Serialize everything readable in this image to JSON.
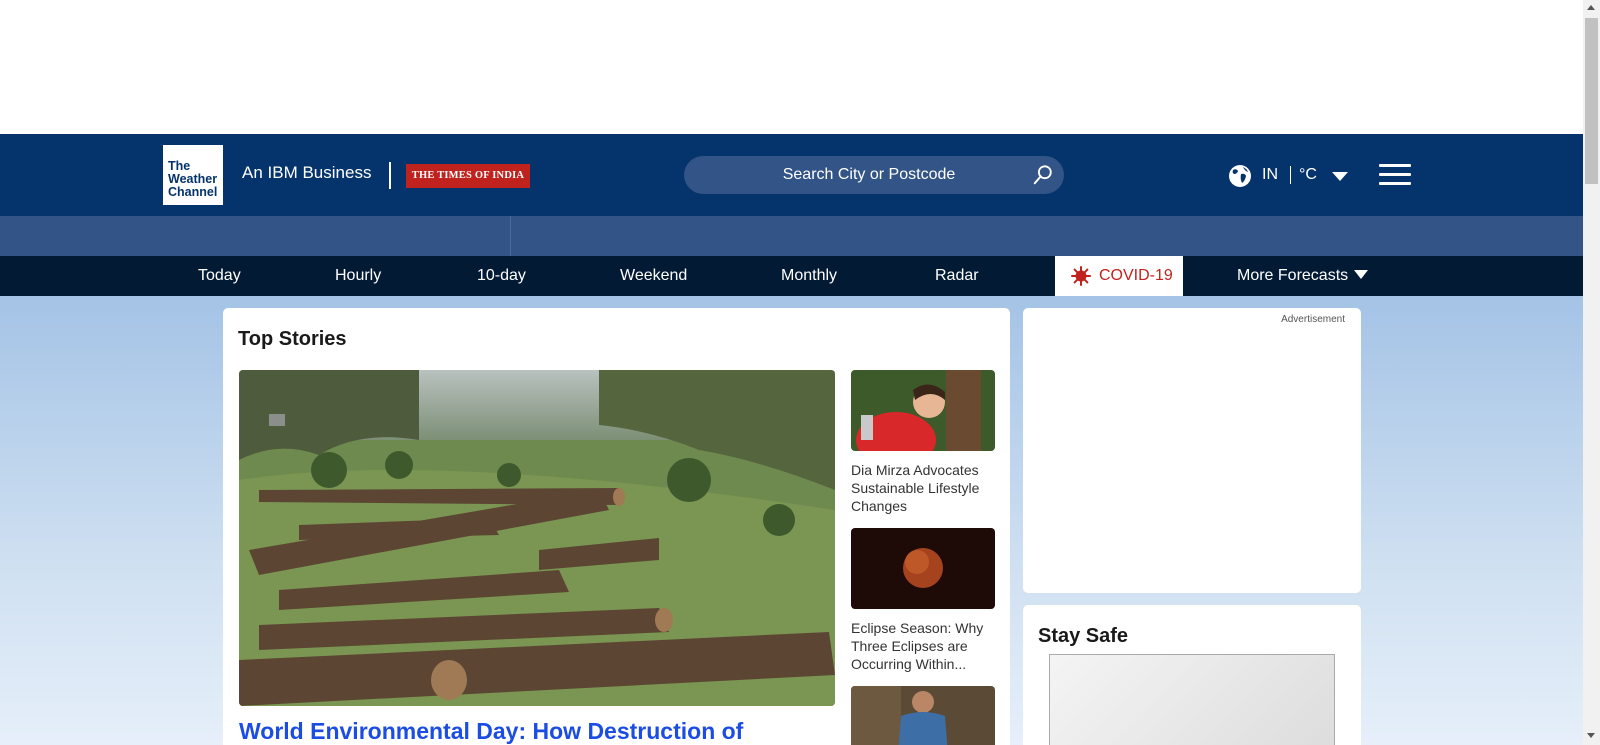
{
  "header": {
    "logo_lines": [
      "The",
      "Weather",
      "Channel"
    ],
    "tagline": "An IBM Business",
    "partner": "THE TIMES OF INDIA",
    "search_placeholder": "Search City or Postcode",
    "region": "IN",
    "unit": "°C"
  },
  "nav": {
    "items": [
      "Today",
      "Hourly",
      "10-day",
      "Weekend",
      "Monthly",
      "Radar"
    ],
    "covid": "COVID-19",
    "more": "More Forecasts"
  },
  "top_stories": {
    "title": "Top Stories",
    "main_headline": "World Environmental Day: How Destruction of",
    "side": [
      {
        "title": "Dia Mirza Advocates Sustainable Lifestyle Changes"
      },
      {
        "title": "Eclipse Season: Why Three Eclipses are Occurring Within..."
      }
    ]
  },
  "ad": {
    "label": "Advertisement"
  },
  "stay_safe": {
    "title": "Stay Safe"
  },
  "colors": {
    "brand": "#05336b",
    "subbar": "#325486",
    "nav": "#031a35",
    "covid": "#c0221e",
    "headline": "#1b4de4"
  }
}
